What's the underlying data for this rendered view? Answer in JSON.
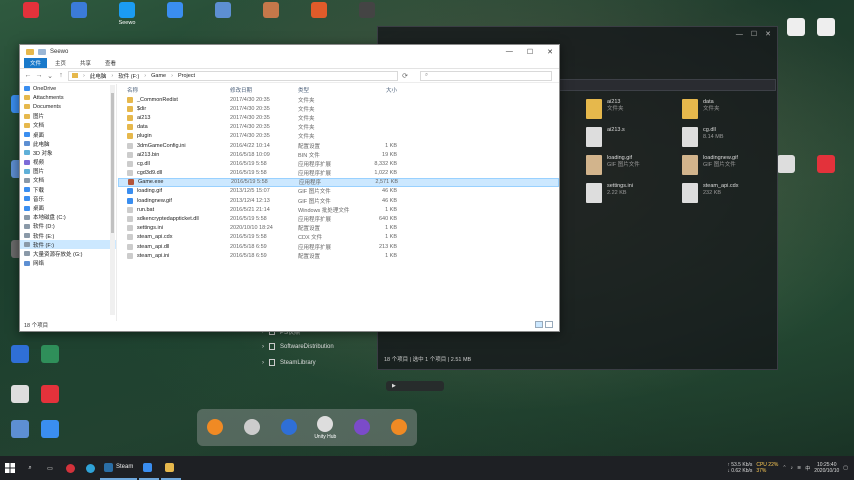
{
  "top_strip": [
    {
      "label": "",
      "color": "#e3323b"
    },
    {
      "label": "",
      "color": "#3b7bd8"
    },
    {
      "label": "Seewo",
      "color": "#1b9cf2"
    },
    {
      "label": "",
      "color": "#3a8ef0"
    },
    {
      "label": "",
      "color": "#5d8fd2"
    },
    {
      "label": "",
      "color": "#c5784a"
    },
    {
      "label": "",
      "color": "#e05b2a"
    },
    {
      "label": "",
      "color": "#444444"
    }
  ],
  "desktop_right_labels": [
    "",
    "",
    "",
    "",
    "",
    "",
    "",
    ""
  ],
  "dark_window": {
    "tree": [
      "PS快照",
      "SoftwareDistribution",
      "SteamLibrary"
    ],
    "files": [
      {
        "name": "ai213",
        "sub": "文件夹",
        "color": "#e6b84c"
      },
      {
        "name": "data",
        "sub": "文件夹",
        "color": "#e6b84c"
      },
      {
        "name": "ai213.s",
        "sub": "",
        "color": "#dddddd"
      },
      {
        "name": "cg.dll",
        "sub": "8.14 MB",
        "color": "#dddddd"
      },
      {
        "name": "loading.gif",
        "sub": "GIF 图片文件",
        "color": "#d2b48c"
      },
      {
        "name": "loadingnew.gif",
        "sub": "GIF 图片文件",
        "color": "#d2b48c"
      },
      {
        "name": "settings.ini",
        "sub": "2.22 KB",
        "color": "#dddddd"
      },
      {
        "name": "steam_api.cdx",
        "sub": "232 KB",
        "color": "#dddddd"
      }
    ],
    "status": "18 个项目  |  选中 1 个项目  |  2.51 MB"
  },
  "window": {
    "title": "Seewo",
    "ribbon_tabs": [
      "文件",
      "主页",
      "共享",
      "查看"
    ],
    "breadcrumb": [
      "此电脑",
      "软件 (F:)",
      "Game",
      "Project"
    ],
    "search_placeholder": "",
    "nav_items": [
      {
        "label": "OneDrive",
        "color": "#3a8ef0",
        "selected": false
      },
      {
        "label": "Attachments",
        "color": "#e6b84c",
        "selected": false
      },
      {
        "label": "Documents",
        "color": "#e6b84c",
        "selected": false
      },
      {
        "label": "图片",
        "color": "#e6b84c",
        "selected": false
      },
      {
        "label": "文档",
        "color": "#e6b84c",
        "selected": false
      },
      {
        "label": "桌面",
        "color": "#3a8ef0",
        "selected": false
      },
      {
        "label": "此电脑",
        "color": "#5d8fd2",
        "selected": false
      },
      {
        "label": "3D 对象",
        "color": "#5fb0d8",
        "selected": false
      },
      {
        "label": "视频",
        "color": "#7c6bd8",
        "selected": false
      },
      {
        "label": "图片",
        "color": "#5fb0d8",
        "selected": false
      },
      {
        "label": "文档",
        "color": "#8a99a8",
        "selected": false
      },
      {
        "label": "下载",
        "color": "#3a8ef0",
        "selected": false
      },
      {
        "label": "音乐",
        "color": "#3a8ef0",
        "selected": false
      },
      {
        "label": "桌面",
        "color": "#3a8ef0",
        "selected": false
      },
      {
        "label": "本地磁盘 (C:)",
        "color": "#8a99a8",
        "selected": false
      },
      {
        "label": "软件 (D:)",
        "color": "#8a99a8",
        "selected": false
      },
      {
        "label": "软件 (E:)",
        "color": "#8a99a8",
        "selected": false
      },
      {
        "label": "软件 (F:)",
        "color": "#8a99a8",
        "selected": true
      },
      {
        "label": "大量资源存放处 (G:)",
        "color": "#8a99a8",
        "selected": false
      },
      {
        "label": "网络",
        "color": "#5d8fd2",
        "selected": false
      }
    ],
    "columns": {
      "name": "名称",
      "date": "修改日期",
      "type": "类型",
      "size": "大小"
    },
    "files": [
      {
        "name": "_CommonRedist",
        "date": "2017/4/30 20:35",
        "type": "文件夹",
        "size": "",
        "color": "#e6b84c"
      },
      {
        "name": "$dir",
        "date": "2017/4/30 20:35",
        "type": "文件夹",
        "size": "",
        "color": "#e6b84c"
      },
      {
        "name": "ai213",
        "date": "2017/4/30 20:35",
        "type": "文件夹",
        "size": "",
        "color": "#e6b84c"
      },
      {
        "name": "data",
        "date": "2017/4/30 20:35",
        "type": "文件夹",
        "size": "",
        "color": "#e6b84c"
      },
      {
        "name": "plugin",
        "date": "2017/4/30 20:35",
        "type": "文件夹",
        "size": "",
        "color": "#e6b84c"
      },
      {
        "name": "3dmGameConfig.ini",
        "date": "2016/4/22 10:14",
        "type": "配置设置",
        "size": "1 KB",
        "color": "#cccccc"
      },
      {
        "name": "ai213.bin",
        "date": "2016/5/18 10:09",
        "type": "BIN 文件",
        "size": "19 KB",
        "color": "#cccccc"
      },
      {
        "name": "cg.dll",
        "date": "2016/5/19 5:58",
        "type": "应用程序扩展",
        "size": "8,332 KB",
        "color": "#cccccc"
      },
      {
        "name": "cgd3d9.dll",
        "date": "2016/5/19 5:58",
        "type": "应用程序扩展",
        "size": "1,022 KB",
        "color": "#cccccc"
      },
      {
        "name": "Game.exe",
        "date": "2016/5/19 5:58",
        "type": "应用程序",
        "size": "2,571 KB",
        "color": "#b3553b"
      },
      {
        "name": "loading.gif",
        "date": "2013/12/5 15:07",
        "type": "GIF 图片文件",
        "size": "46 KB",
        "color": "#3a8ef0"
      },
      {
        "name": "loadingnew.gif",
        "date": "2013/12/4 12:13",
        "type": "GIF 图片文件",
        "size": "46 KB",
        "color": "#3a8ef0"
      },
      {
        "name": "run.bat",
        "date": "2016/5/21 21:14",
        "type": "Windows 批处理文件",
        "size": "1 KB",
        "color": "#cccccc"
      },
      {
        "name": "sdkencryptedappticket.dll",
        "date": "2016/5/19 5:58",
        "type": "应用程序扩展",
        "size": "640 KB",
        "color": "#cccccc"
      },
      {
        "name": "settings.ini",
        "date": "2020/10/10 18:24",
        "type": "配置设置",
        "size": "1 KB",
        "color": "#cccccc"
      },
      {
        "name": "steam_api.cdx",
        "date": "2016/5/19 5:58",
        "type": "CDX 文件",
        "size": "1 KB",
        "color": "#cccccc"
      },
      {
        "name": "steam_api.dll",
        "date": "2016/5/18 6:59",
        "type": "应用程序扩展",
        "size": "213 KB",
        "color": "#cccccc"
      },
      {
        "name": "steam_api.ini",
        "date": "2016/5/18 6:59",
        "type": "配置设置",
        "size": "1 KB",
        "color": "#cccccc"
      }
    ],
    "selected_index": 9,
    "status": "18 个项目"
  },
  "dock": [
    {
      "label": "",
      "color": "#f08a24"
    },
    {
      "label": "",
      "color": "#cccccc"
    },
    {
      "label": "",
      "color": "#2f6fd6"
    },
    {
      "label": "Unity Hub",
      "color": "#dddddd"
    },
    {
      "label": "",
      "color": "#7b4bc9"
    },
    {
      "label": "",
      "color": "#f08a24"
    }
  ],
  "small_pill": "",
  "taskbar": {
    "apps": [
      {
        "label": "Steam",
        "color": "#2a6ea6"
      },
      {
        "label": "",
        "color": "#3a8ef0"
      },
      {
        "label": "",
        "color": "#e6b84c"
      }
    ],
    "net_up": "↑ 53.5 Kb/s",
    "net_down": "↓ 0.62 Kb/s",
    "cpu": "CPU 22%",
    "mem": "37%",
    "time": "10:25:40",
    "date": "2020/10/10"
  }
}
